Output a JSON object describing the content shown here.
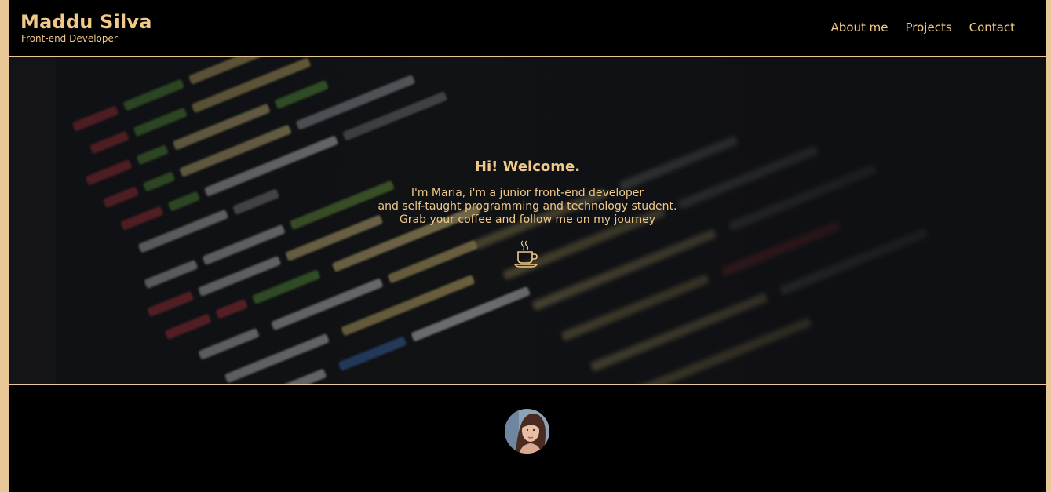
{
  "header": {
    "name": "Maddu Silva",
    "subtitle": "Front-end Developer",
    "nav": [
      "About me",
      "Projects",
      "Contact"
    ]
  },
  "hero": {
    "title": "Hi! Welcome.",
    "lines": [
      "I'm Maria, i'm a junior front-end developer",
      "and self-taught programming and technology student.",
      "Grab your coffee and follow me on my journey"
    ],
    "icon": "coffee-cup-icon"
  },
  "profile": {
    "avatar": "profile-photo"
  },
  "colors": {
    "accent": "#f0c98a",
    "frame": "#e8c896",
    "background": "#000000"
  }
}
